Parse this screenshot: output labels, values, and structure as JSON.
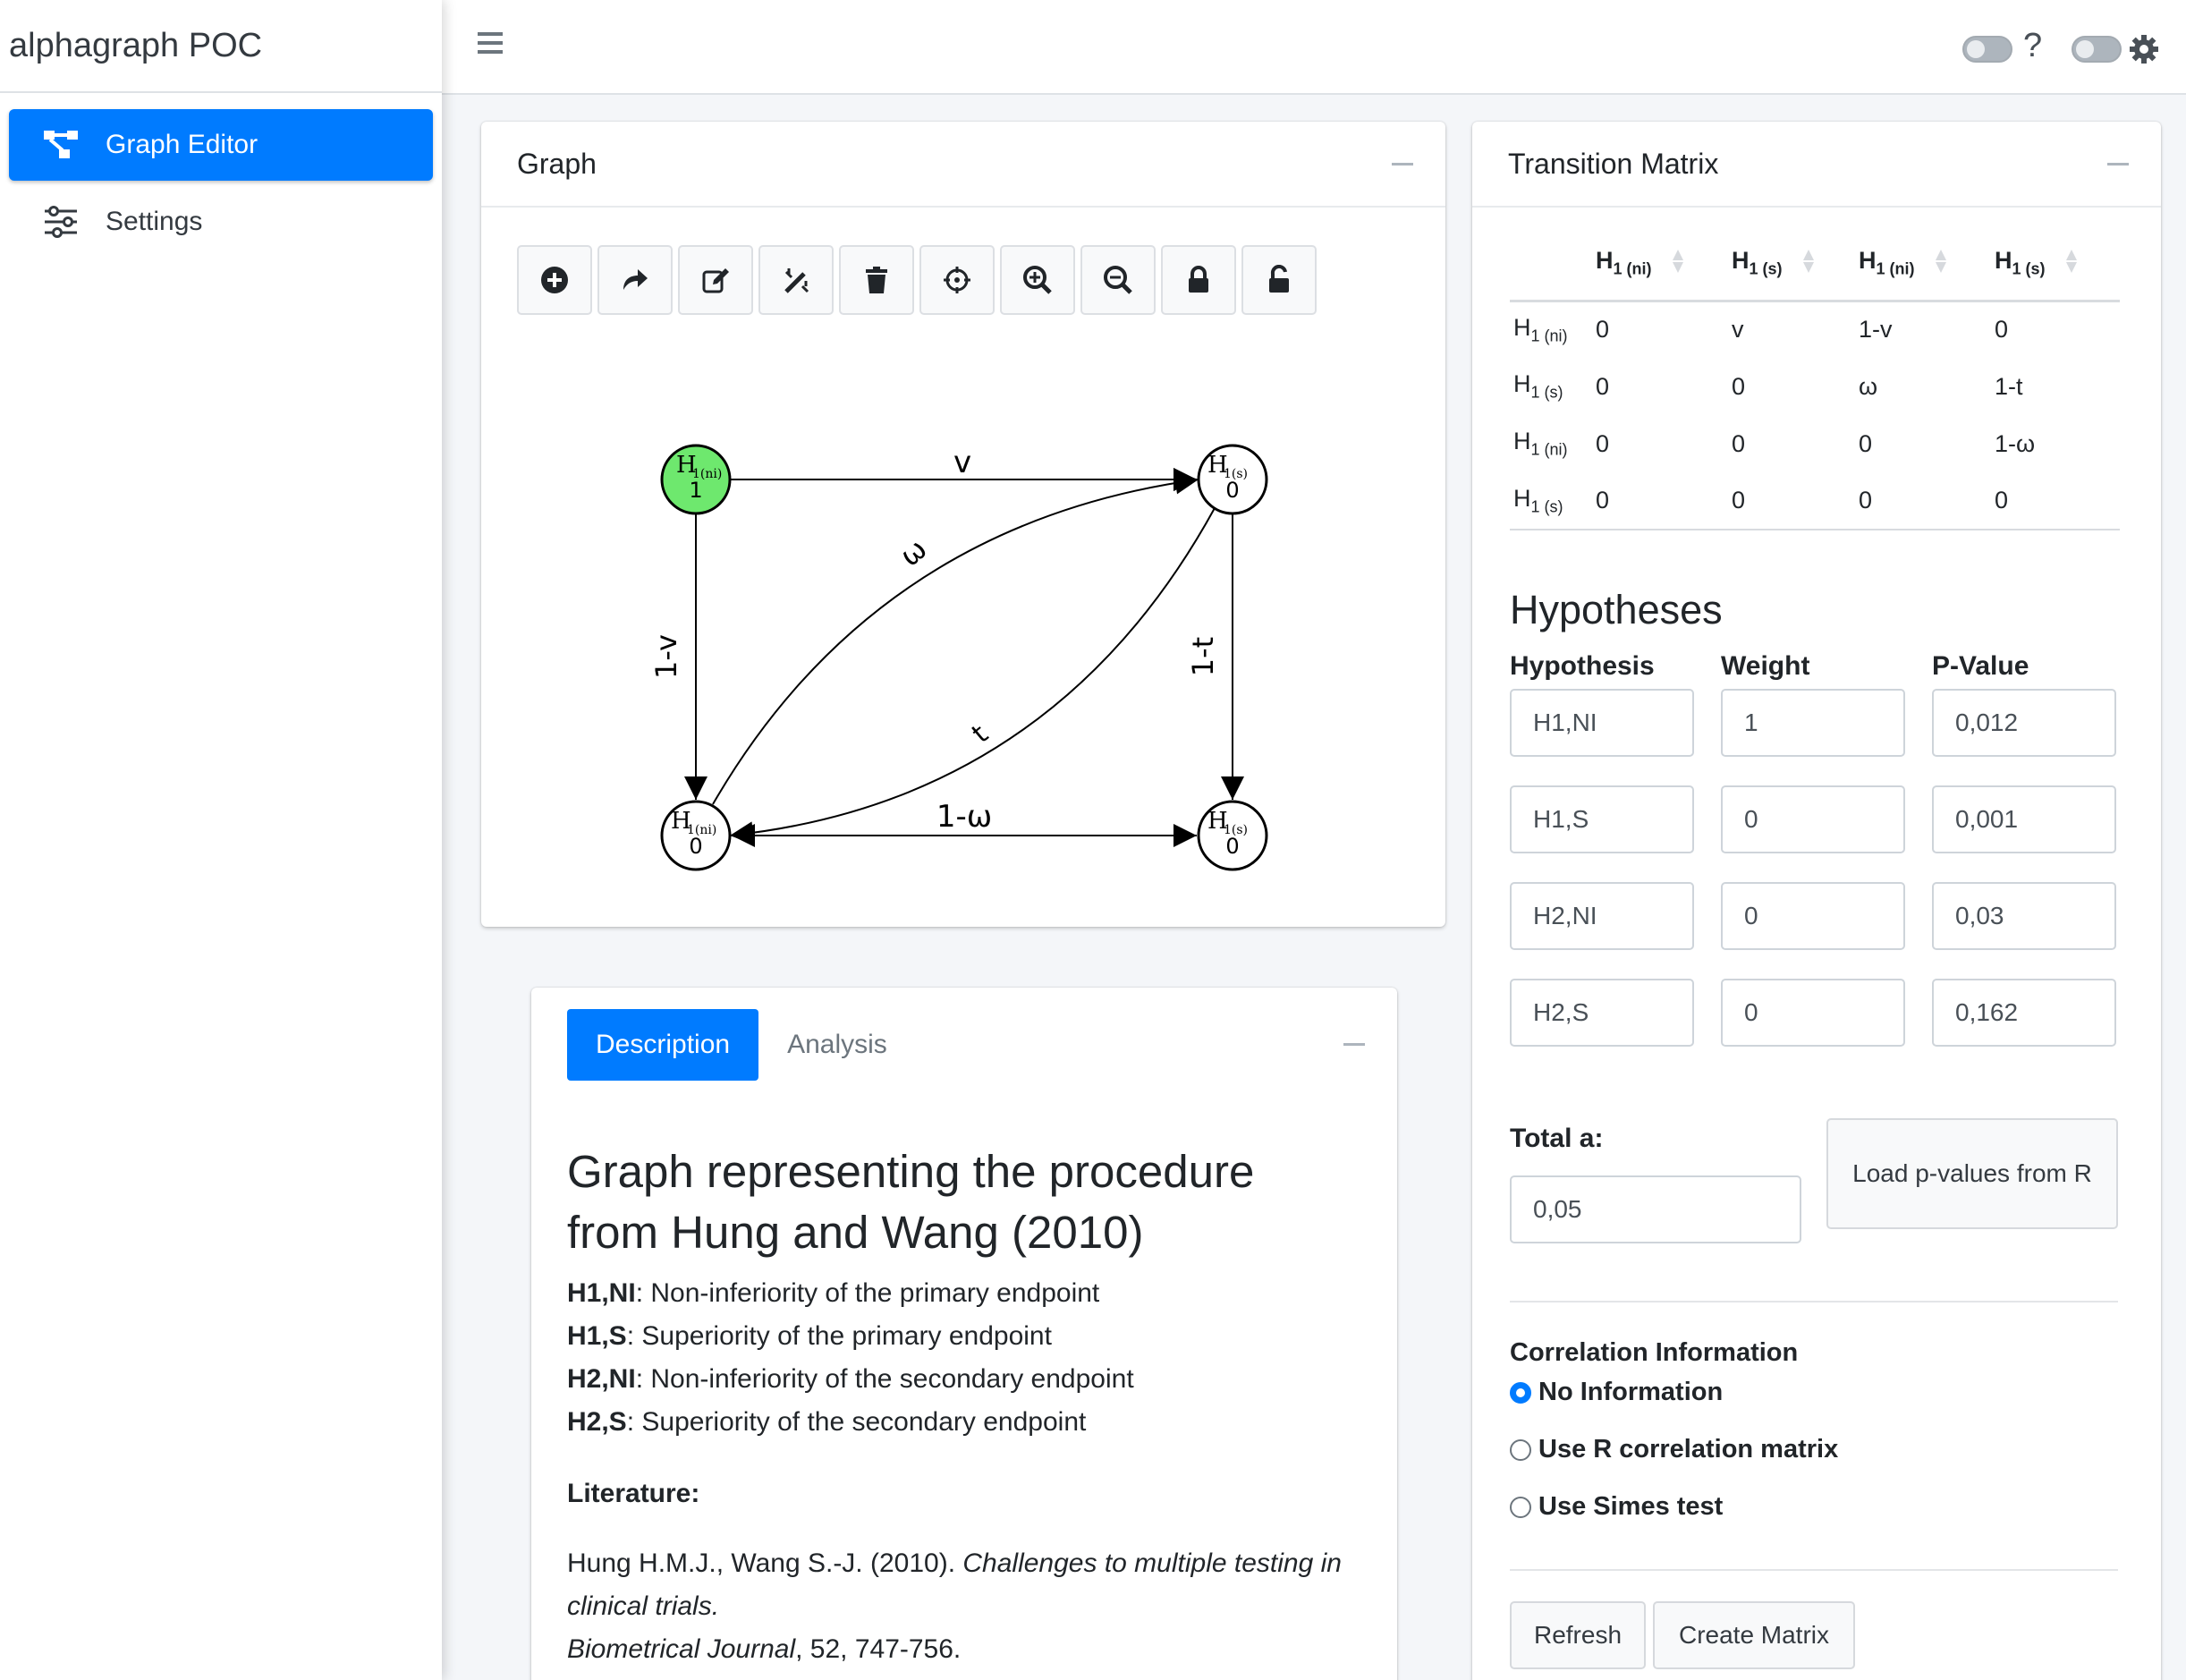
{
  "app": {
    "title": "alphagraph POC"
  },
  "sidebar": {
    "items": [
      {
        "label": "Graph Editor",
        "icon": "graph-icon",
        "active": true
      },
      {
        "label": "Settings",
        "icon": "sliders-icon",
        "active": false
      }
    ]
  },
  "topbar": {
    "help_label": "?"
  },
  "graph_card": {
    "title": "Graph",
    "toolbar": [
      "add-node-icon",
      "share-icon",
      "edit-icon",
      "magic-wand-icon",
      "trash-icon",
      "crosshair-icon",
      "zoom-in-icon",
      "zoom-out-icon",
      "lock-icon",
      "unlock-icon"
    ],
    "nodes": [
      {
        "name": "H",
        "sub": "1(ni)",
        "weight": "1",
        "highlighted": true
      },
      {
        "name": "H",
        "sub": "1(s)",
        "weight": "0",
        "highlighted": false
      },
      {
        "name": "H",
        "sub": "1(ni)",
        "weight": "0",
        "highlighted": false
      },
      {
        "name": "H",
        "sub": "1(s)",
        "weight": "0",
        "highlighted": false
      }
    ],
    "edge_labels": {
      "top": "v",
      "diag_up": "ω",
      "left": "1-v",
      "right": "1-t",
      "diag_down": "t",
      "bottom": "1-ω"
    },
    "highlight_color": "#6ee86e"
  },
  "matrix_card": {
    "title": "Transition Matrix",
    "headers": [
      {
        "main": "H",
        "sub": "1 (ni)"
      },
      {
        "main": "H",
        "sub": "1 (s)"
      },
      {
        "main": "H",
        "sub": "1 (ni)"
      },
      {
        "main": "H",
        "sub": "1 (s)"
      }
    ],
    "rows": [
      {
        "main": "H",
        "sub": "1 (ni)",
        "cells": [
          "0",
          "v",
          "1-v",
          "0"
        ]
      },
      {
        "main": "H",
        "sub": "1 (s)",
        "cells": [
          "0",
          "0",
          "ω",
          "1-t"
        ]
      },
      {
        "main": "H",
        "sub": "1 (ni)",
        "cells": [
          "0",
          "0",
          "0",
          "1-ω"
        ]
      },
      {
        "main": "H",
        "sub": "1 (s)",
        "cells": [
          "0",
          "0",
          "0",
          "0"
        ]
      }
    ],
    "hypotheses": {
      "title": "Hypotheses",
      "col_hypothesis": "Hypothesis",
      "col_weight": "Weight",
      "col_pvalue": "P-Value",
      "rows": [
        {
          "hypothesis": "H1,NI",
          "weight": "1",
          "pvalue": "0,012"
        },
        {
          "hypothesis": "H1,S",
          "weight": "0",
          "pvalue": "0,001"
        },
        {
          "hypothesis": "H2,NI",
          "weight": "0",
          "pvalue": "0,03"
        },
        {
          "hypothesis": "H2,S",
          "weight": "0",
          "pvalue": "0,162"
        }
      ]
    },
    "total_label": "Total a:",
    "total_value": "0,05",
    "load_button": "Load p-values from R",
    "correlation": {
      "title": "Correlation Information",
      "options": [
        {
          "label": "No Information",
          "selected": true
        },
        {
          "label": "Use R correlation matrix",
          "selected": false
        },
        {
          "label": "Use Simes test",
          "selected": false
        }
      ]
    },
    "refresh_button": "Refresh",
    "create_button": "Create Matrix"
  },
  "info_card": {
    "tabs": [
      {
        "label": "Description",
        "active": true
      },
      {
        "label": "Analysis",
        "active": false
      }
    ],
    "heading": "Graph representing the procedure from Hung and Wang (2010)",
    "definitions": [
      {
        "term": "H1,NI",
        "text": ": Non-inferiority of the primary endpoint"
      },
      {
        "term": "H1,S",
        "text": ": Superiority of the primary endpoint"
      },
      {
        "term": "H2,NI",
        "text": ": Non-inferiority of the secondary endpoint"
      },
      {
        "term": "H2,S",
        "text": ": Superiority of the secondary endpoint"
      }
    ],
    "literature_label": "Literature:",
    "citation": {
      "authors": "Hung H.M.J., Wang S.-J. (2010). ",
      "title": "Challenges to multiple testing in clinical trials.",
      "journal": "Biometrical Journal",
      "rest": ", 52, 747-756."
    }
  }
}
